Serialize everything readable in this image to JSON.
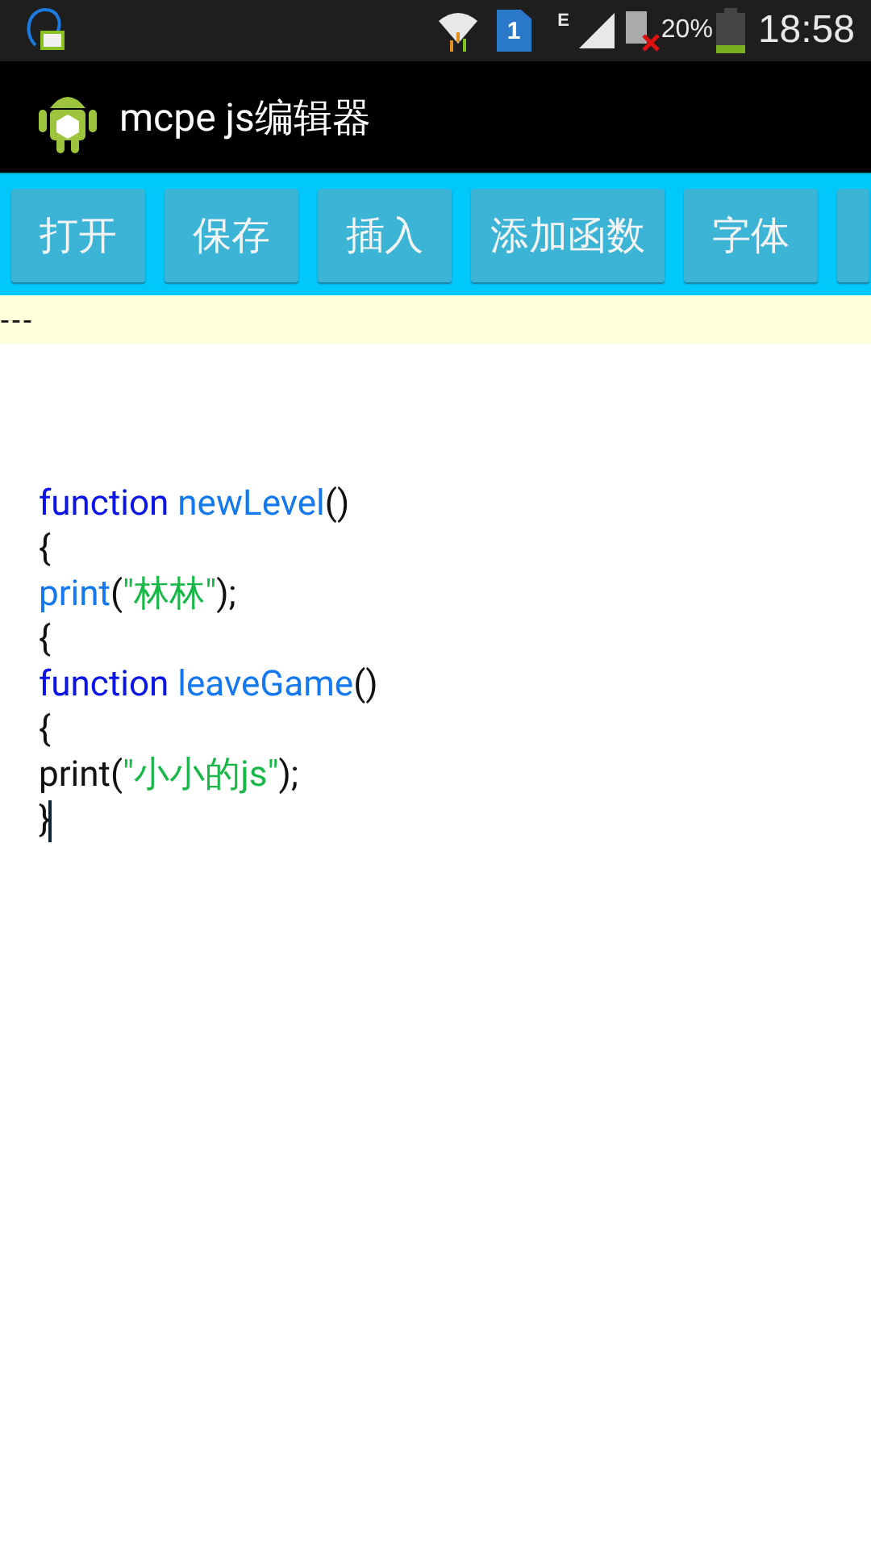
{
  "status_bar": {
    "sim_slot": "1",
    "network_type": "E",
    "battery_percent": "20%",
    "time": "18:58"
  },
  "app_bar": {
    "title": "mcpe js编辑器"
  },
  "toolbar": {
    "buttons": [
      {
        "label": "打开"
      },
      {
        "label": "保存"
      },
      {
        "label": "插入"
      },
      {
        "label": "添加函数"
      },
      {
        "label": "字体"
      }
    ],
    "more_buttons_cut_off": true
  },
  "info_bar": {
    "text": "---"
  },
  "editor": {
    "lines": [
      {
        "tokens": [
          {
            "kind": "keyword",
            "text": "function "
          },
          {
            "kind": "name",
            "text": "newLevel"
          },
          {
            "kind": "plain",
            "text": "()"
          }
        ]
      },
      {
        "tokens": [
          {
            "kind": "plain",
            "text": "{"
          }
        ]
      },
      {
        "tokens": [
          {
            "kind": "name",
            "text": "print"
          },
          {
            "kind": "plain",
            "text": "("
          },
          {
            "kind": "string",
            "text": "\"林林\""
          },
          {
            "kind": "plain",
            "text": ");"
          }
        ]
      },
      {
        "tokens": [
          {
            "kind": "plain",
            "text": "{"
          }
        ]
      },
      {
        "tokens": [
          {
            "kind": "keyword",
            "text": "function "
          },
          {
            "kind": "name",
            "text": "leaveGame"
          },
          {
            "kind": "plain",
            "text": "()"
          }
        ]
      },
      {
        "tokens": [
          {
            "kind": "plain",
            "text": "{"
          }
        ]
      },
      {
        "tokens": [
          {
            "kind": "plain",
            "text": "print("
          },
          {
            "kind": "string",
            "text": "\"小小的js\""
          },
          {
            "kind": "plain",
            "text": ");"
          }
        ]
      },
      {
        "tokens": [
          {
            "kind": "plain",
            "text": "}"
          }
        ],
        "cursor_at_end": true
      }
    ]
  }
}
